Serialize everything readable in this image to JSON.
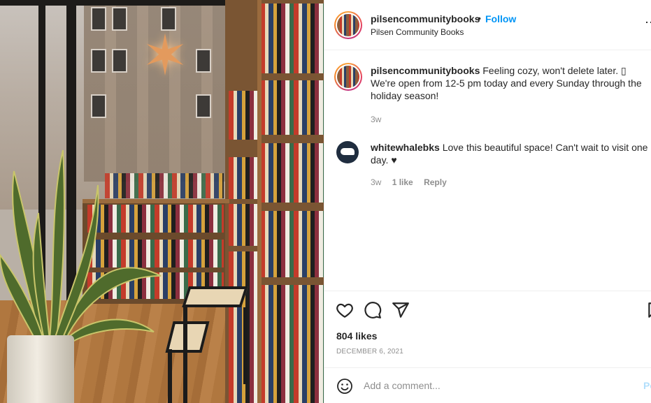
{
  "post": {
    "author": "pilsencommunitybooks",
    "author_display_name": "Pilsen Community Books",
    "follow_label": "Follow",
    "separator": "•",
    "more_label": "⋯"
  },
  "comments": [
    {
      "username": "pilsencommunitybooks",
      "text": "Feeling cozy, won't delete later. ▯ We're open from 12-5 pm today and every Sunday through the holiday season!",
      "time": "3w"
    },
    {
      "username": "whitewhalebks",
      "text": "Love this beautiful space! Can't wait to visit one day. ♥",
      "time": "3w",
      "likes": "1 like",
      "reply_label": "Reply"
    }
  ],
  "actions": {
    "like_icon": "heart-icon",
    "comment_icon": "comment-icon",
    "share_icon": "send-icon",
    "save_icon": "bookmark-icon"
  },
  "likes_count": "804 likes",
  "date": "DECEMBER 6, 2021",
  "add_comment": {
    "placeholder": "Add a comment...",
    "post_label": "Po"
  },
  "colors": {
    "accent": "#0095f6",
    "post_disabled": "#b2dffc",
    "text": "#262626",
    "muted": "#8e8e8e"
  }
}
